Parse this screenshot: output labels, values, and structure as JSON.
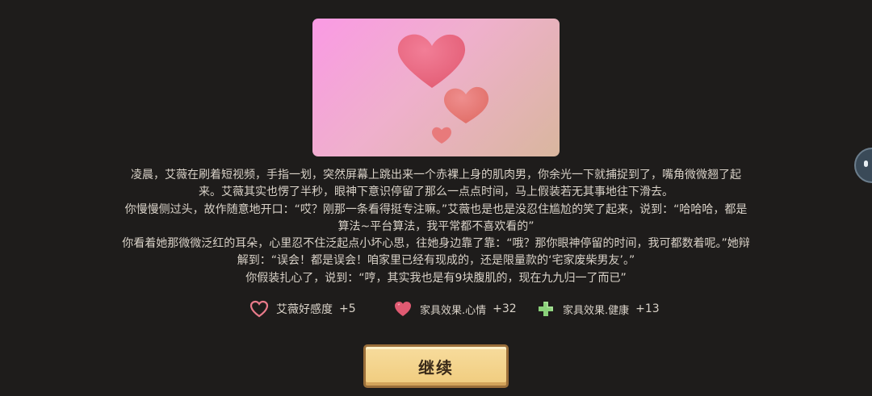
{
  "story": {
    "paragraphs": [
      "凌晨，艾薇在刷着短视频，手指一划，突然屏幕上跳出来一个赤裸上身的肌肉男，你余光一下就捕捉到了，嘴角微微翘了起来。艾薇其实也愣了半秒，眼神下意识停留了那么一点点时间，马上假装若无其事地往下滑去。",
      "你慢慢侧过头，故作随意地开口：“哎？刚那一条看得挺专注嘛。”艾薇也是也是没忍住尴尬的笑了起来，说到：“哈哈哈，都是算法~平台算法，我平常都不喜欢看的”",
      "你看着她那微微泛红的耳朵，心里忍不住泛起点小坏心思，往她身边靠了靠：“哦？那你眼神停留的时间，我可都数着呢。”她辩解到：“误会！都是误会！咱家里已经有现成的，还是限量款的‘宅家废柴男友’。”",
      "你假装扎心了，说到：“哼，其实我也是有9块腹肌的，现在九九归一了而已”"
    ]
  },
  "effects": [
    {
      "label": "艾薇好感度",
      "value": "+5",
      "icon": "heart-outline-icon",
      "color": "#e87a8a"
    },
    {
      "label": "家具效果.心情",
      "value": "+32",
      "icon": "heart-filled-icon",
      "color": "#e05a72"
    },
    {
      "label": "家具效果.健康",
      "value": "+13",
      "icon": "green-cross-icon",
      "color": "#8ad07a"
    }
  ],
  "continue_label": "继续",
  "colors": {
    "background": "#1e1c1b",
    "text": "#d9d2c8",
    "button": "#f0cc7e",
    "image_pink": "#fa9ae4"
  }
}
